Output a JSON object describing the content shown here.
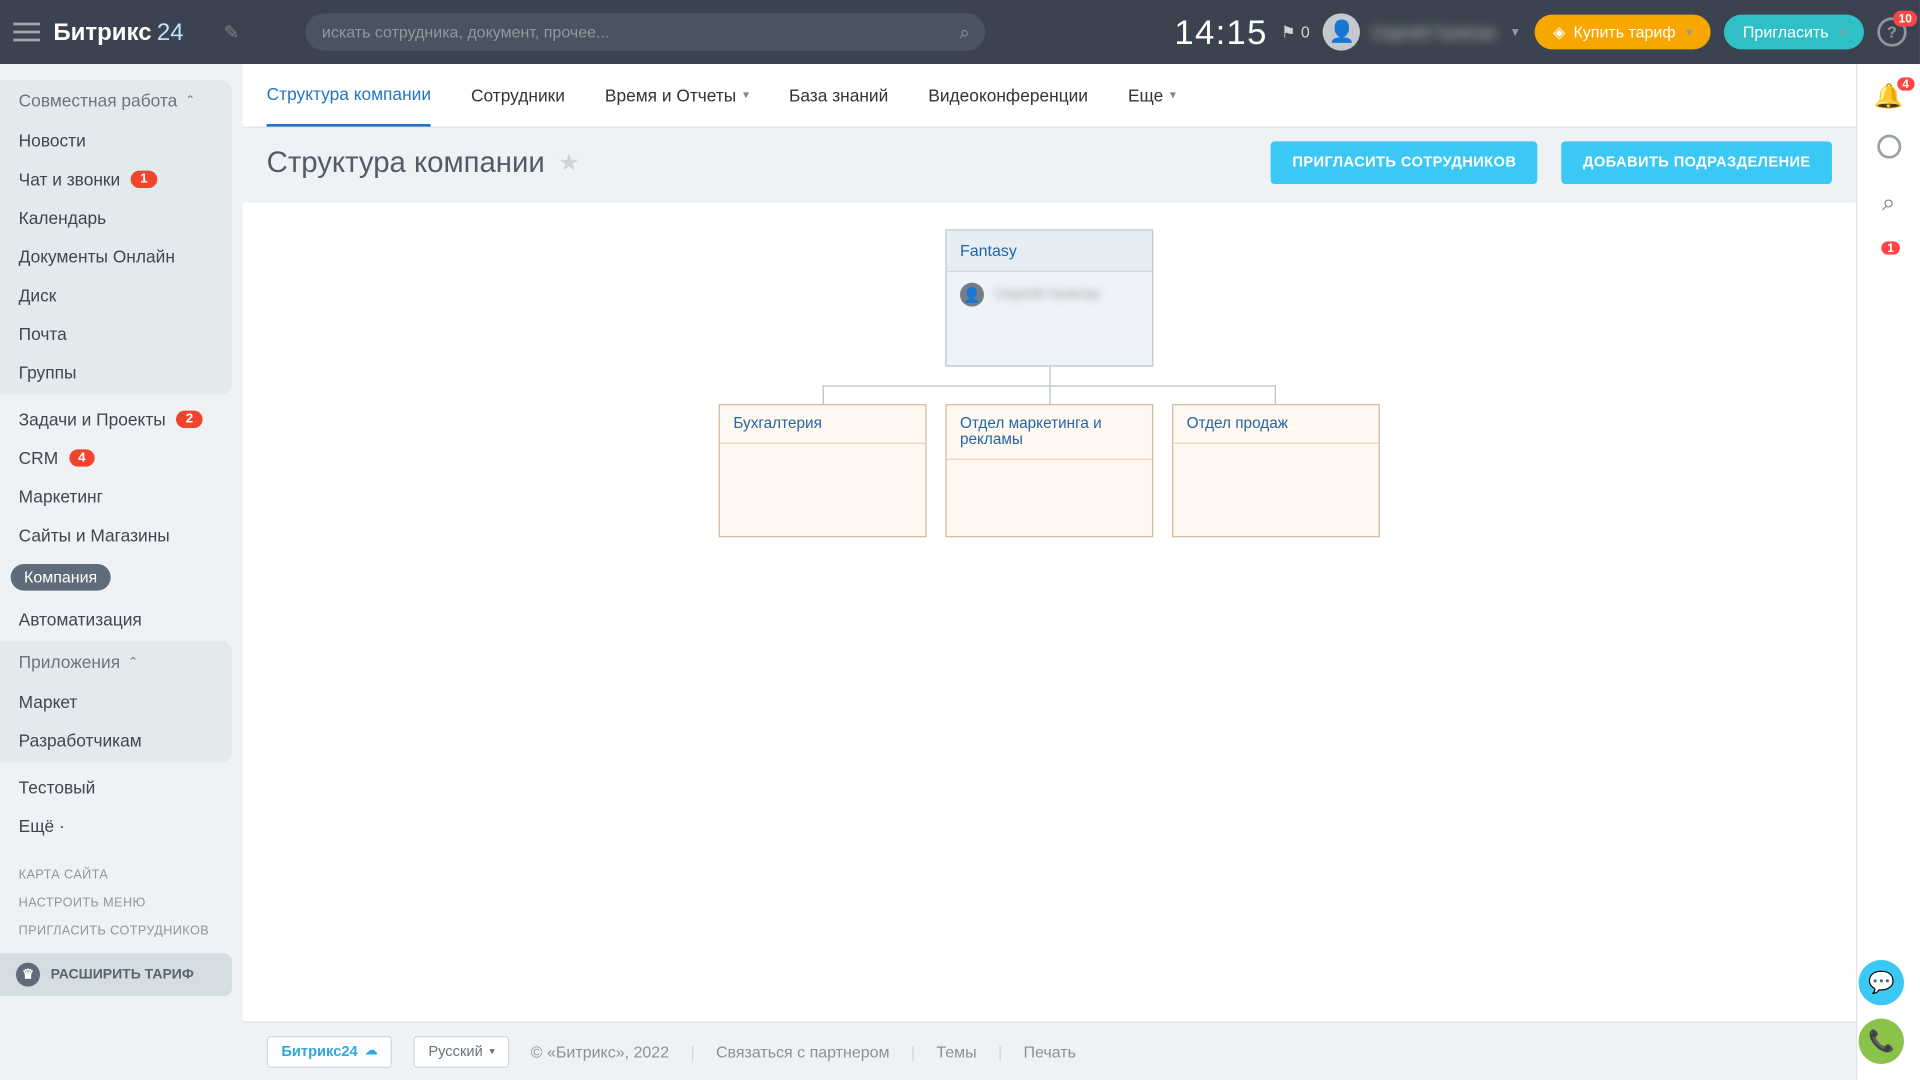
{
  "header": {
    "logo": {
      "text1": "Битрикс",
      "text2": "24"
    },
    "search_placeholder": "искать сотрудника, документ, прочее...",
    "clock": "14:15",
    "flag_count": "0",
    "user_name": "Сергей Галеган",
    "buy_tariff": "Купить тариф",
    "invite": "Пригласить",
    "help_count": "10"
  },
  "sidebar": {
    "group1_head": "Совместная работа",
    "items1": [
      {
        "label": "Новости",
        "badge": null
      },
      {
        "label": "Чат и звонки",
        "badge": "1"
      },
      {
        "label": "Календарь",
        "badge": null
      },
      {
        "label": "Документы Онлайн",
        "badge": null
      },
      {
        "label": "Диск",
        "badge": null
      },
      {
        "label": "Почта",
        "badge": null
      },
      {
        "label": "Группы",
        "badge": null
      }
    ],
    "items_flat": [
      {
        "label": "Задачи и Проекты",
        "badge": "2"
      },
      {
        "label": "CRM",
        "badge": "4"
      },
      {
        "label": "Маркетинг",
        "badge": null
      },
      {
        "label": "Сайты и Магазины",
        "badge": null
      },
      {
        "label": "Компания",
        "badge": null,
        "active": true
      },
      {
        "label": "Автоматизация",
        "badge": null
      }
    ],
    "group2_head": "Приложения",
    "items2": [
      {
        "label": "Маркет"
      },
      {
        "label": "Разработчикам"
      }
    ],
    "items_tail": [
      {
        "label": "Тестовый"
      },
      {
        "label": "Ещё ·"
      }
    ],
    "small": [
      "КАРТА САЙТА",
      "НАСТРОИТЬ МЕНЮ",
      "ПРИГЛАСИТЬ СОТРУДНИКОВ"
    ],
    "upgrade": "РАСШИРИТЬ ТАРИФ"
  },
  "tabs": [
    {
      "label": "Структура компании",
      "active": true
    },
    {
      "label": "Сотрудники"
    },
    {
      "label": "Время и Отчеты",
      "dropdown": true
    },
    {
      "label": "База знаний"
    },
    {
      "label": "Видеоконференции"
    },
    {
      "label": "Еще",
      "dropdown": true
    }
  ],
  "page_title": "Структура компании",
  "action_buttons": {
    "invite_employees": "ПРИГЛАСИТЬ СОТРУДНИКОВ",
    "add_department": "ДОБАВИТЬ ПОДРАЗДЕЛЕНИЕ"
  },
  "org": {
    "root": {
      "name": "Fantasy",
      "person": "Сергей Галеган"
    },
    "children": [
      {
        "name": "Бухгалтерия"
      },
      {
        "name": "Отдел маркетинга и рекламы"
      },
      {
        "name": "Отдел продаж"
      }
    ]
  },
  "footer": {
    "brand": "Битрикс24",
    "language": "Русский",
    "copyright": "© «Битрикс», 2022",
    "links": [
      "Связаться с партнером",
      "Темы",
      "Печать"
    ]
  },
  "rail": {
    "bell_badge": "4",
    "avatar_badge": "1"
  }
}
